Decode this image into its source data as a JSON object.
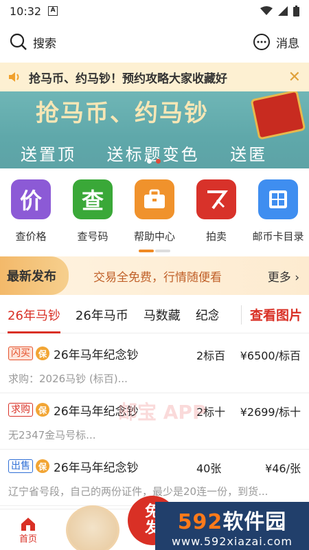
{
  "status": {
    "time": "10:32",
    "a_icon": "A"
  },
  "topbar": {
    "search_label": "搜索",
    "message_label": "消息"
  },
  "notice": {
    "text": "抢马币、约马钞！预约攻略大家收藏好"
  },
  "banner": {
    "title": "抢马币、约马钞",
    "perks": [
      "送置顶",
      "送标题变色",
      "送匿名"
    ]
  },
  "grid": {
    "items": [
      {
        "label": "查价格",
        "glyph": "价",
        "color": "#8c5ad6"
      },
      {
        "label": "查号码",
        "glyph": "查",
        "color": "#3aa838"
      },
      {
        "label": "帮助中心",
        "glyph": "",
        "color": "#f0922c"
      },
      {
        "label": "拍卖",
        "glyph": "",
        "color": "#d8322a"
      },
      {
        "label": "邮币卡目录",
        "glyph": "",
        "color": "#3f8ef0"
      }
    ]
  },
  "latest": {
    "tag": "最新发布",
    "slogan": "交易全免费，行情随便看",
    "more": "更多"
  },
  "tabs": {
    "items": [
      "26年马钞",
      "26年马币",
      "马数藏",
      "纪念"
    ],
    "view_pics": "查看图片"
  },
  "listings": [
    {
      "badge": "闪买",
      "bao": "保",
      "name": "26年马年纪念钞",
      "qty": "2标百",
      "price": "¥6500/标百",
      "desc": "求购：2026马钞 (标百)..."
    },
    {
      "badge": "求购",
      "bao": "保",
      "name": "26年马年纪念钞",
      "qty": "2标十",
      "price": "¥2699/标十",
      "desc": "无2347金马号标..."
    },
    {
      "badge": "出售",
      "bao": "保",
      "name": "26年马年纪念钞",
      "qty": "40张",
      "price": "¥46/张",
      "desc": "辽宁省号段，自己的两份证件，最少是20连一份，到货..."
    }
  ],
  "watermark": "邮宝 APP",
  "bottom_nav": {
    "home": "首页",
    "free_button": [
      "免",
      "发"
    ]
  },
  "brand": {
    "num": "592",
    "name": "软件园",
    "url": "www.592xiazai.com"
  }
}
